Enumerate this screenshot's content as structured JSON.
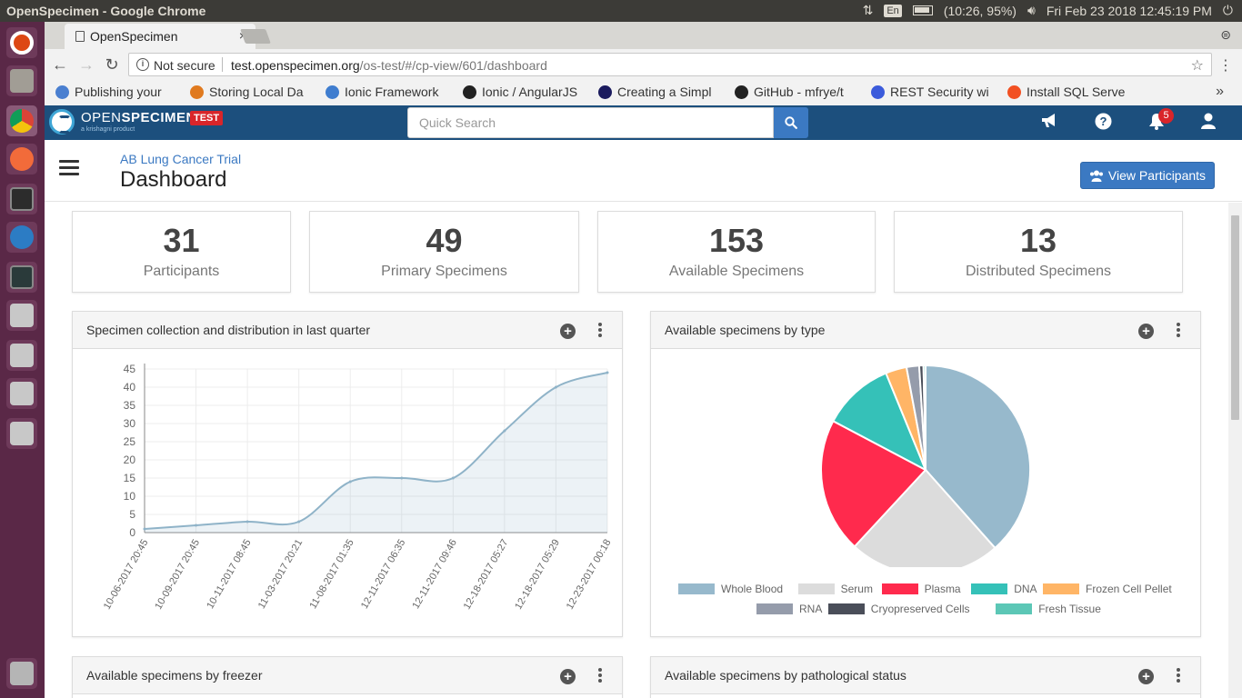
{
  "os": {
    "window_title": "OpenSpecimen - Google Chrome",
    "input_lang": "En",
    "battery": "(10:26, 95%)",
    "datetime": "Fri Feb 23 2018 12:45:19 PM"
  },
  "browser": {
    "tab_title": "OpenSpecimen",
    "tab_close": "×",
    "security_label": "Not secure",
    "url_host": "test.openspecimen.org",
    "url_path": "/os-test/#/cp-view/601/dashboard",
    "bookmarks": [
      {
        "label": "Publishing your",
        "icon_color": "#4a7fd0"
      },
      {
        "label": "Storing Local Da",
        "icon_color": "#e07a1f"
      },
      {
        "label": "Ionic Framework",
        "icon_color": "#3f7dcf"
      },
      {
        "label": "Ionic / AngularJS",
        "icon_color": "#222222"
      },
      {
        "label": "Creating a Simpl",
        "icon_color": "#1b1b5e"
      },
      {
        "label": "GitHub - mfrye/t",
        "icon_color": "#222222"
      },
      {
        "label": "REST Security wi",
        "icon_color": "#3b5bdb"
      },
      {
        "label": "Install SQL Serve",
        "icon_color": "#f25022"
      }
    ],
    "bookmarks_more": "»"
  },
  "app": {
    "brand_light": "OPEN",
    "brand_bold": "SPECIMEN",
    "brand_sub": "a krishagni product",
    "env_badge": "TEST",
    "search_placeholder": "Quick Search",
    "notification_count": "5",
    "accent": "#3b79c2",
    "header_bg": "#1c4f7d"
  },
  "page": {
    "protocol": "AB Lung Cancer Trial",
    "title": "Dashboard",
    "view_participants": "View Participants"
  },
  "stats": [
    {
      "value": "31",
      "label": "Participants"
    },
    {
      "value": "49",
      "label": "Primary Specimens"
    },
    {
      "value": "153",
      "label": "Available Specimens"
    },
    {
      "value": "13",
      "label": "Distributed Specimens"
    }
  ],
  "panels": {
    "collection": "Specimen collection and distribution in last quarter",
    "by_type": "Available specimens by type",
    "by_freezer": "Available specimens by freezer",
    "by_path_status": "Available specimens by pathological status"
  },
  "chart_data": [
    {
      "type": "area",
      "title": "Specimen collection and distribution in last quarter",
      "categories": [
        "10-06-2017 20:45",
        "10-09-2017 20:45",
        "10-11-2017 08:45",
        "11-03-2017 20:21",
        "11-08-2017 01:35",
        "12-11-2017 06:35",
        "12-11-2017 09:46",
        "12-18-2017 05:27",
        "12-18-2017 05:29",
        "12-23-2017 00:18"
      ],
      "values": [
        1,
        2,
        3,
        3,
        14,
        15,
        15,
        28,
        40,
        44
      ],
      "ylim": [
        0,
        45
      ],
      "yticks": [
        0,
        5,
        10,
        15,
        20,
        25,
        30,
        35,
        40,
        45
      ],
      "grid": true,
      "color": "#8fb3c8"
    },
    {
      "type": "pie",
      "title": "Available specimens by type",
      "legend_position": "bottom",
      "slices": [
        {
          "label": "Whole Blood",
          "value": 59,
          "color": "#97b9cc"
        },
        {
          "label": "Serum",
          "value": 36,
          "color": "#dcdcdc"
        },
        {
          "label": "Plasma",
          "value": 32,
          "color": "#ff2a4d"
        },
        {
          "label": "DNA",
          "value": 17,
          "color": "#35c1b8"
        },
        {
          "label": "Frozen Cell Pellet",
          "value": 5,
          "color": "#ffb566"
        },
        {
          "label": "RNA",
          "value": 3,
          "color": "#959cab"
        },
        {
          "label": "Cryopreserved Cells",
          "value": 1,
          "color": "#4a4e59"
        },
        {
          "label": "Fresh Tissue",
          "value": 0.5,
          "color": "#5cc7b6"
        }
      ]
    }
  ]
}
